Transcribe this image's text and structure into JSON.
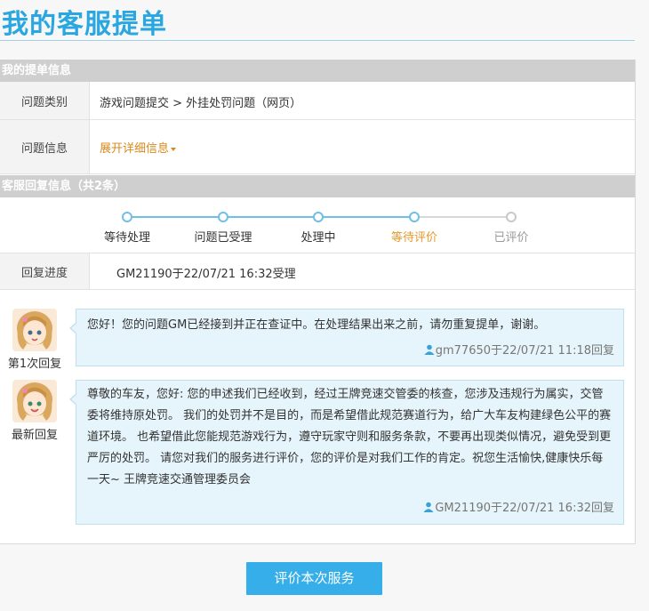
{
  "page_title": "我的客服提单",
  "ticket_section": {
    "title": "我的提单信息",
    "category_label": "问题类别",
    "category_value": "游戏问题提交 > 外挂处罚问题（网页）",
    "info_label": "问题信息",
    "expand_link": "展开详细信息"
  },
  "reply_section": {
    "title": "客服回复信息（共2条）",
    "steps": [
      {
        "label": "等待处理",
        "state": "done"
      },
      {
        "label": "问题已受理",
        "state": "done"
      },
      {
        "label": "处理中",
        "state": "done"
      },
      {
        "label": "等待评价",
        "state": "current"
      },
      {
        "label": "已评价",
        "state": "todo"
      }
    ],
    "progress_label": "回复进度",
    "progress_value": "GM21190于22/07/21 16:32受理"
  },
  "replies": [
    {
      "caption": "第1次回复",
      "text": "您好！您的问题GM已经接到并正在查证中。在处理结果出来之前，请勿重复提单，谢谢。",
      "meta": "gm77650于22/07/21 11:18回复"
    },
    {
      "caption": "最新回复",
      "text": "尊敬的车友，您好:          您的申述我们已经收到，经过王牌竞速交管委的核查，您涉及违规行为属实，交管委将维持原处罚。         我们的处罚并不是目的，而是希望借此规范赛道行为，给广大车友构建绿色公平的赛道环境。         也希望借此您能规范游戏行为，遵守玩家守则和服务条款，不要再出现类似情况，避免受到更严厉的处罚。         请您对我们的服务进行评价，您的评价是对我们工作的肯定。祝您生活愉快,健康快乐每一天~ 王牌竞速交通管理委员会",
      "meta": "GM21190于22/07/21 16:32回复"
    }
  ],
  "rate_button": "评价本次服务",
  "colors": {
    "accent": "#2aa7e0",
    "button": "#35aee9",
    "section_bar": "#cfcfcf",
    "link_orange": "#d98a1c",
    "bubble_bg": "#e6f4fb"
  },
  "icons": {
    "avatar": "anime-girl-avatar-icon",
    "reply_author": "person-icon",
    "expand": "caret-down-icon"
  }
}
